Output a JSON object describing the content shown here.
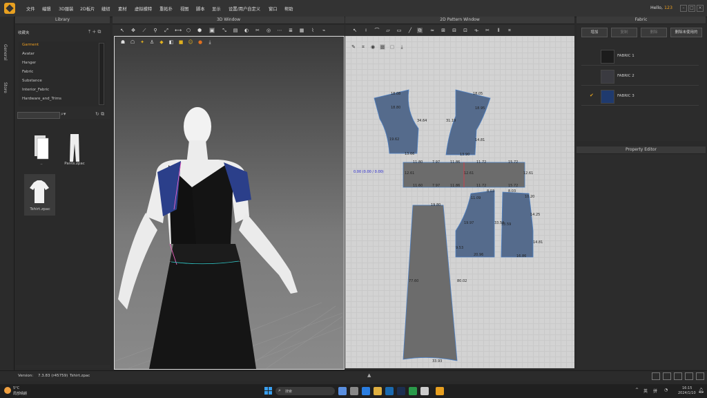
{
  "menubar": {
    "items": [
      "文件",
      "编辑",
      "3D服装",
      "2D板片",
      "缝纫",
      "素材",
      "虚拟模特",
      "重拓扑",
      "视图",
      "脚本",
      "显示",
      "设置/用户自定义",
      "窗口",
      "帮助"
    ],
    "greeting": "Hello,",
    "user": "123"
  },
  "left_tabs": [
    "General",
    "Store"
  ],
  "library": {
    "title": "Library",
    "favorites_label": "收藏夹",
    "tree": [
      "Garment",
      "Avatar",
      "Hanger",
      "Fabric",
      "Substance",
      "Interior_Fabric",
      "Hardware_and_Trims"
    ],
    "files": [
      {
        "name": ".."
      },
      {
        "name": "Pants.zpac"
      },
      {
        "name": "Tshirt.zpac"
      }
    ]
  },
  "window3d": {
    "title": "3D Window"
  },
  "window2d": {
    "title": "2D Pattern Window",
    "coord_readout": "0.00 (0.00 / 0.00)",
    "measurements": [
      "18.08",
      "18.80",
      "34.64",
      "19.62",
      "13.66",
      "18.05",
      "18.95",
      "31.19",
      "14.81",
      "13.90",
      "11.80",
      "7.97",
      "11.86",
      "12.61",
      "11.72",
      "15.72",
      "12.61",
      "11.60",
      "7.97",
      "11.86",
      "11.72",
      "15.72",
      "12.61",
      "8.03",
      "11.09",
      "8.03",
      "10.20",
      "19.80",
      "19.97",
      "33.59",
      "33.59",
      "14.25",
      "9.53",
      "20.96",
      "14.81",
      "16.86",
      "77.60",
      "80.02",
      "33.93"
    ]
  },
  "fabric_panel": {
    "title": "Fabric",
    "buttons": [
      "增加",
      "复制",
      "删除",
      "删除未使用的"
    ],
    "items": [
      {
        "name": "FABRIC 1",
        "color": "#1c1c1c",
        "selected": false
      },
      {
        "name": "FABRIC 2",
        "color": "#3a3a40",
        "selected": false
      },
      {
        "name": "FABRIC 3",
        "color": "#1f3a6e",
        "selected": true
      }
    ]
  },
  "property_editor": {
    "title": "Property Editor"
  },
  "statusbar": {
    "version_label": "Version:",
    "version": "7.3.83 (r45759)",
    "file": "Tshirt.zpac"
  },
  "taskbar": {
    "weather_temp": "5°C",
    "weather_desc": "局部晴朗",
    "search_placeholder": "搜索",
    "lang1": "英",
    "lang2": "拼",
    "time": "16:15",
    "date": "2024/1/10"
  }
}
